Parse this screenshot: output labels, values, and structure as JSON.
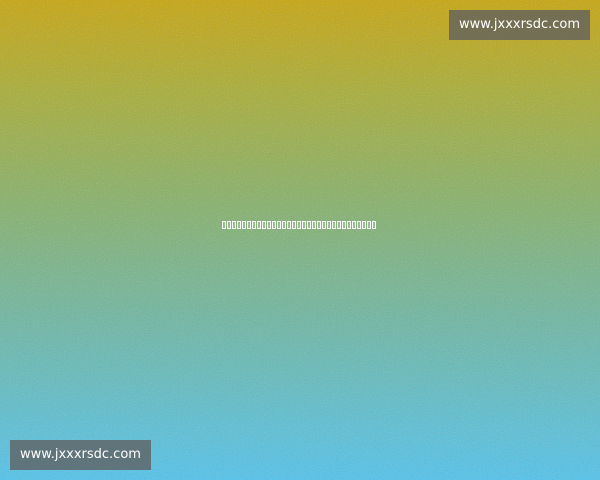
{
  "watermark": {
    "top_right_text": "www.jxxxrsdc.com",
    "bottom_left_text": "www.jxxxrsdc.com"
  },
  "center": {
    "missing_glyph_count": 31
  },
  "colors": {
    "gradient_top": "#c8a404",
    "gradient_mid": "#86b060",
    "gradient_bottom": "#4cc4ef",
    "watermark_bg": "#5f5f5f"
  }
}
